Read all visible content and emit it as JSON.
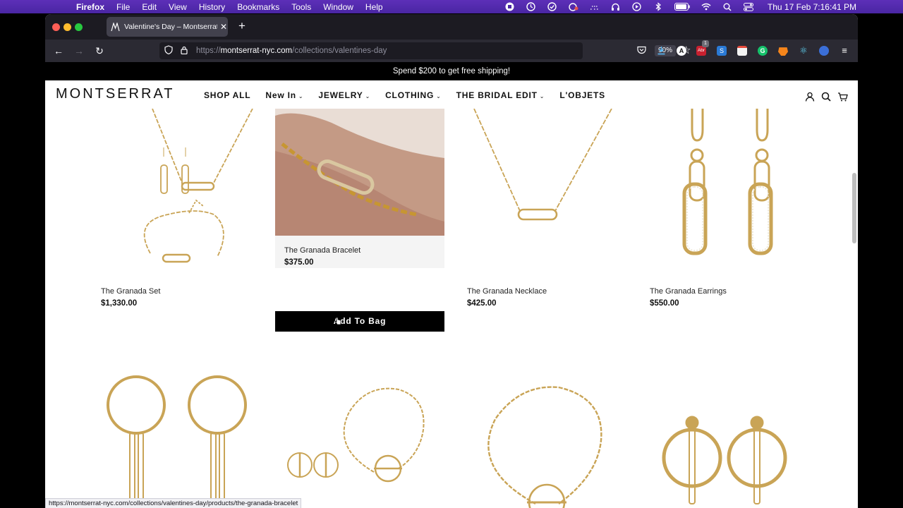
{
  "menubar": {
    "app": "Firefox",
    "items": [
      "File",
      "Edit",
      "View",
      "History",
      "Bookmarks",
      "Tools",
      "Window",
      "Help"
    ],
    "clock": "Thu 17 Feb  7:16:41 PM"
  },
  "browser": {
    "tab_title": "Valentine's Day – Montserrat New York",
    "url_prefix": "https://",
    "url_host": "montserrat-nyc.com",
    "url_path": "/collections/valentines-day",
    "zoom": "90%",
    "extension_badge": "1",
    "extension_abr": "Abr",
    "status_url": "https://montserrat-nyc.com/collections/valentines-day/products/the-granada-bracelet"
  },
  "site": {
    "promo": "Spend $200 to get free shipping!",
    "logo": "MONTSERRAT",
    "nav": [
      {
        "label": "SHOP ALL",
        "dropdown": false
      },
      {
        "label": "New In",
        "dropdown": true
      },
      {
        "label": "JEWELRY",
        "dropdown": true
      },
      {
        "label": "CLOTHING",
        "dropdown": true
      },
      {
        "label": "THE BRIDAL EDIT",
        "dropdown": true
      },
      {
        "label": "L'OBJETS",
        "dropdown": false
      }
    ]
  },
  "products": [
    {
      "name": "The Granada Set",
      "price": "$1,330.00"
    },
    {
      "name": "The Granada Bracelet",
      "price": "$375.00",
      "button": "Add To Bag"
    },
    {
      "name": "The Granada Necklace",
      "price": "$425.00"
    },
    {
      "name": "The Granada Earrings",
      "price": "$550.00"
    }
  ],
  "colors": {
    "menubar": "#4a26a3",
    "browser_chrome": "#2b2a33",
    "gold": "#c9a456",
    "accent_button": "#000000"
  }
}
